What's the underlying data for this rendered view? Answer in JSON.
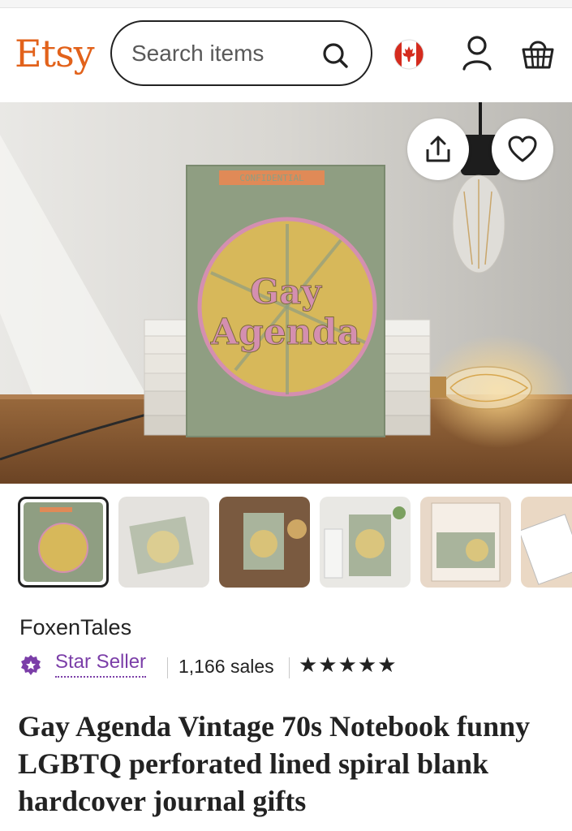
{
  "header": {
    "logo": "Etsy",
    "search_placeholder": "Search items"
  },
  "listing": {
    "shop_name": "FoxenTales",
    "badge": "Star Seller",
    "sales": "1,166 sales",
    "rating_stars": "★★★★★",
    "title": "Gay Agenda Vintage 70s Notebook funny LGBTQ perforated lined spiral blank hardcover journal gifts"
  },
  "hero": {
    "book_label": "CONFIDENTIAL",
    "book_title_line1": "Gay",
    "book_title_line2": "Agenda"
  },
  "icons": {
    "search": "search-icon",
    "flag": "canada-flag-icon",
    "account": "user-icon",
    "cart": "basket-icon",
    "share": "share-icon",
    "favorite": "heart-icon",
    "badge": "star-badge-icon"
  },
  "colors": {
    "brand": "#e2621b",
    "star_seller": "#7b3ea8",
    "text": "#222222"
  }
}
